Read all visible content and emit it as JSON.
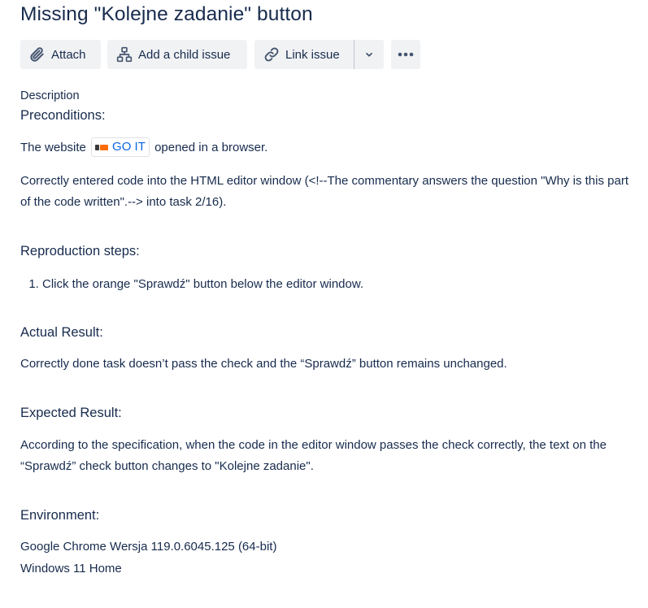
{
  "issue": {
    "title": "Missing \"Kolejne zadanie\" button"
  },
  "toolbar": {
    "attach_label": "Attach",
    "attach_icon": "paperclip-icon",
    "add_child_label": "Add a child issue",
    "add_child_icon": "child-issue-icon",
    "link_issue_label": "Link issue",
    "link_issue_icon": "link-icon",
    "dropdown_icon": "chevron-down-icon",
    "more_icon": "more-horizontal-icon"
  },
  "description": {
    "label": "Description",
    "preconditions": {
      "heading": "Preconditions:",
      "line1_before": "The website",
      "smart_link_text": "GO IT",
      "line1_after": "opened in a browser.",
      "line2": "Correctly entered code into the HTML editor window (<!--The commentary answers the question \"Why is this part of the code written\".--> into task 2/16)."
    },
    "reproduction": {
      "heading": "Reproduction steps:",
      "steps": [
        "Click the orange \"Sprawdź\" button below the editor window."
      ]
    },
    "actual": {
      "heading": "Actual Result:",
      "text": "Correctly done task doesn’t pass the check and the “Sprawdź” button remains unchanged."
    },
    "expected": {
      "heading": "Expected Result:",
      "text": "According to the specification, when the code in the editor window passes the check correctly, the text on the “Sprawdź” check button changes to \"Kolejne zadanie\"."
    },
    "environment": {
      "heading": "Environment:",
      "line1": "Google Chrome Wersja 119.0.6045.125 (64-bit)",
      "line2": "Windows 11 Home"
    }
  },
  "colors": {
    "text": "#172b4d",
    "button_bg": "#f1f2f4",
    "link": "#0c66e4",
    "brand_orange": "#ff6b08"
  }
}
